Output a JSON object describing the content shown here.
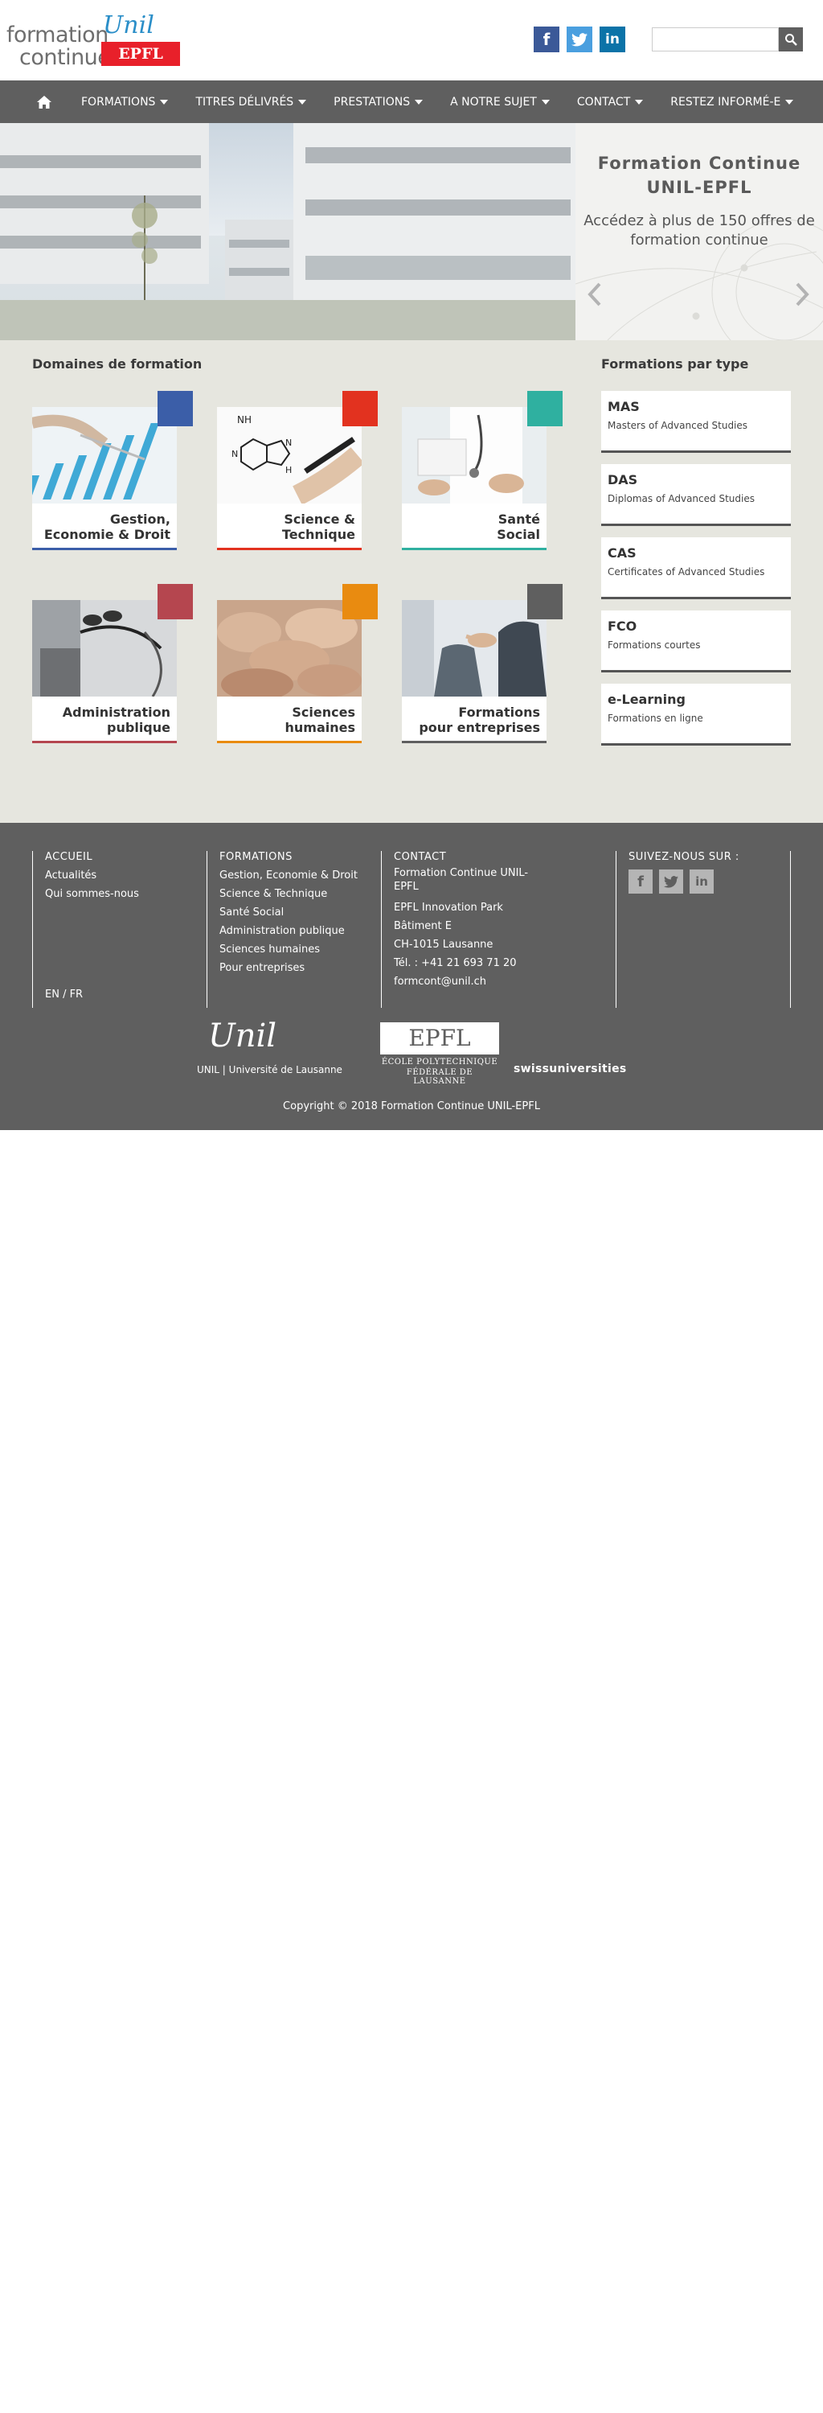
{
  "header": {
    "logo_word1": "formation",
    "logo_word2": "continue",
    "logo_unil": "Unil",
    "logo_epfl": "EPFL",
    "social": [
      {
        "name": "facebook",
        "glyph": "f"
      },
      {
        "name": "twitter",
        "glyph": "t"
      },
      {
        "name": "linkedin",
        "glyph": "in"
      }
    ],
    "search_placeholder": ""
  },
  "nav": {
    "items": [
      "FORMATIONS",
      "TITRES DÉLIVRÉS",
      "PRESTATIONS",
      "A NOTRE SUJET",
      "CONTACT",
      "RESTEZ INFORMÉ-E"
    ]
  },
  "banner": {
    "title": "Formation Continue UNIL-EPFL",
    "subtitle": "Accédez à plus de 150 offres de formation continue"
  },
  "domains": {
    "title": "Domaines de formation",
    "cards": [
      {
        "label_1": "Gestion,",
        "label_2": "Economie & Droit",
        "color": "#3b5ea8"
      },
      {
        "label_1": "Science &",
        "label_2": "Technique",
        "color": "#e2321f"
      },
      {
        "label_1": "Santé",
        "label_2": "Social",
        "color": "#2fb0a0"
      },
      {
        "label_1": "Administration",
        "label_2": "publique",
        "color": "#b5464f"
      },
      {
        "label_1": "Sciences",
        "label_2": "humaines",
        "color": "#e98b10"
      },
      {
        "label_1": "Formations",
        "label_2": "pour entreprises",
        "color": "#5f5f5f"
      }
    ]
  },
  "types": {
    "title": "Formations par type",
    "items": [
      {
        "name": "MAS",
        "desc": "Masters of Advanced Studies"
      },
      {
        "name": "DAS",
        "desc": "Diplomas of Advanced Studies"
      },
      {
        "name": "CAS",
        "desc": "Certificates of Advanced Studies"
      },
      {
        "name": "FCO",
        "desc": "Formations courtes"
      },
      {
        "name": "e-Learning",
        "desc": "Formations en ligne"
      }
    ]
  },
  "footer": {
    "col1": {
      "heading": "ACCUEIL",
      "links": [
        "Actualités",
        "Qui sommes-nous"
      ],
      "lang": "EN / FR"
    },
    "col2": {
      "heading": "FORMATIONS",
      "links": [
        "Gestion, Economie & Droit",
        "Science & Technique",
        "Santé Social",
        "Administration publique",
        "Sciences humaines",
        "Pour entreprises"
      ]
    },
    "col3": {
      "heading": "CONTACT",
      "lines": [
        "Formation Continue UNIL-EPFL",
        "EPFL Innovation Park",
        "Bâtiment E",
        "CH-1015 Lausanne",
        "Tél. : +41 21 693 71 20",
        "formcont@unil.ch"
      ]
    },
    "col4": {
      "heading": "SUIVEZ-NOUS SUR :"
    },
    "logo_unil_script": "Unil",
    "logo_unil_text": "UNIL | Université de Lausanne",
    "logo_epfl": "EPFL",
    "logo_epfl_line1": "ÉCOLE POLYTECHNIQUE",
    "logo_epfl_line2": "FÉDÉRALE DE LAUSANNE",
    "logo_swiss": "swissuniversities",
    "copyright": "Copyright © 2018 Formation Continue UNIL-EPFL"
  }
}
